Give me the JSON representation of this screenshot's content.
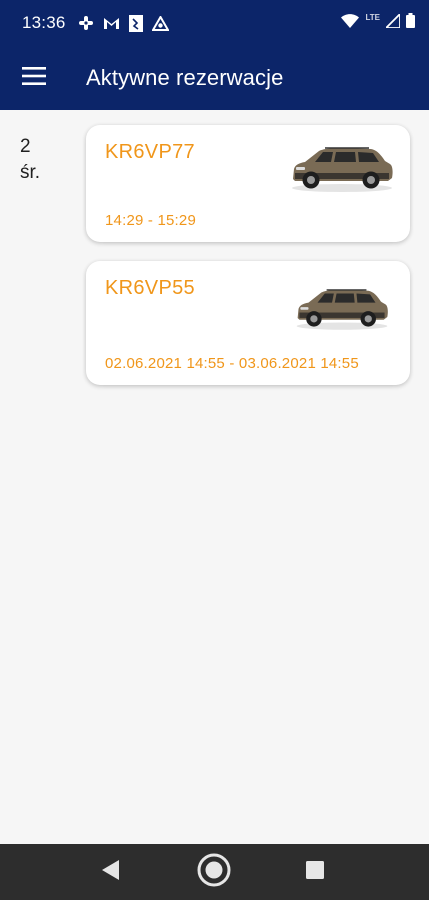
{
  "status_bar": {
    "time": "13:36",
    "network_label": "LTE",
    "icons": [
      "hashtag-icon",
      "gmail-icon",
      "sim-toolkit-icon",
      "recycle-icon",
      "wifi-icon",
      "signal-icon",
      "battery-icon"
    ]
  },
  "app_bar": {
    "title": "Aktywne rezerwacje",
    "menu_icon": "hamburger-menu-icon"
  },
  "day_group": {
    "day_number": "2",
    "weekday": "śr."
  },
  "reservations": [
    {
      "plate": "KR6VP77",
      "time_range": "14:29 - 15:29",
      "image": "car-icon"
    },
    {
      "plate": "KR6VP55",
      "time_range": "02.06.2021 14:55 - 03.06.2021 14:55",
      "image": "car-icon"
    }
  ],
  "colors": {
    "primary": "#0c2569",
    "accent": "#f0961a",
    "background": "#f6f6f6",
    "nav_bar": "#2d2d2d"
  },
  "nav_bar": {
    "buttons": [
      "back-icon",
      "home-icon",
      "recents-icon"
    ]
  }
}
